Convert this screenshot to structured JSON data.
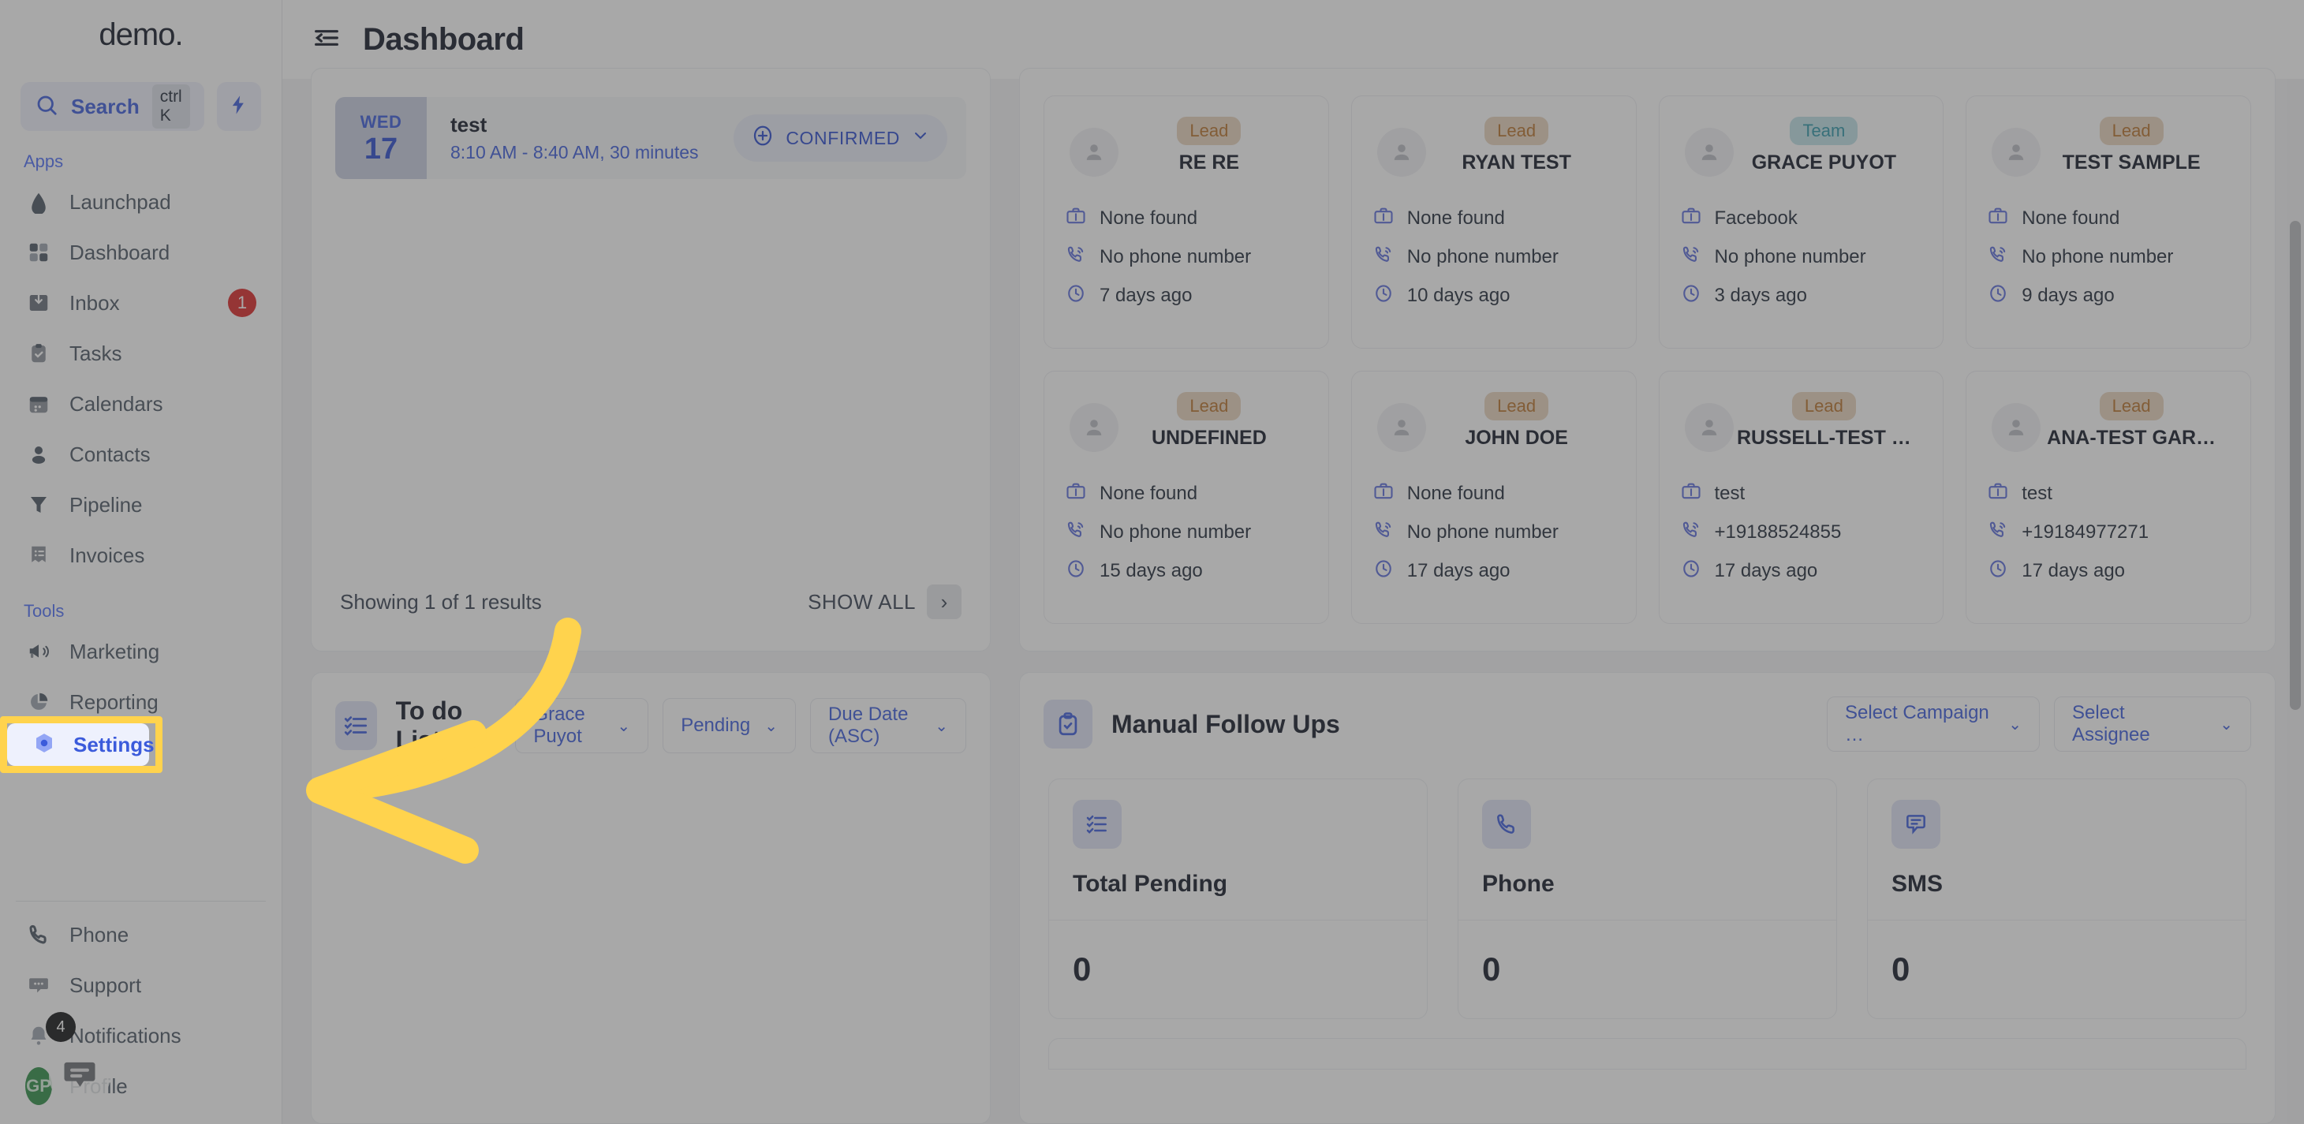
{
  "brand": {
    "name": "demo",
    "trademark": "."
  },
  "topbar": {
    "title": "Dashboard",
    "menu_icon": "collapse-menu-icon"
  },
  "search": {
    "label": "Search",
    "shortcut": "ctrl K",
    "icon": "search-icon",
    "bolt_icon": "bolt-icon"
  },
  "sidebar": {
    "sections": [
      {
        "label": "Apps",
        "items": [
          {
            "label": "Launchpad",
            "icon": "rocket-icon",
            "badge": ""
          },
          {
            "label": "Dashboard",
            "icon": "grid-icon",
            "badge": ""
          },
          {
            "label": "Inbox",
            "icon": "inbox-icon",
            "badge": "1"
          },
          {
            "label": "Tasks",
            "icon": "clipboard-check-icon",
            "badge": ""
          },
          {
            "label": "Calendars",
            "icon": "calendar-icon",
            "badge": ""
          },
          {
            "label": "Contacts",
            "icon": "person-icon",
            "badge": ""
          },
          {
            "label": "Pipeline",
            "icon": "funnel-icon",
            "badge": ""
          },
          {
            "label": "Invoices",
            "icon": "receipt-icon",
            "badge": ""
          }
        ]
      },
      {
        "label": "Tools",
        "items": [
          {
            "label": "Marketing",
            "icon": "megaphone-icon",
            "badge": ""
          },
          {
            "label": "Reporting",
            "icon": "pie-chart-icon",
            "badge": ""
          },
          {
            "label": "Settings",
            "icon": "hexagon-dot-icon",
            "badge": ""
          }
        ]
      }
    ],
    "bottom_items": [
      {
        "label": "Phone",
        "icon": "phone-icon",
        "badge": ""
      },
      {
        "label": "Support",
        "icon": "chat-dots-icon",
        "badge": ""
      },
      {
        "label": "Notifications",
        "icon": "bell-icon",
        "badge": "4"
      },
      {
        "label": "Profile",
        "icon": "avatar",
        "badge": ""
      }
    ],
    "profile_initials": "GP",
    "active_item": "Settings"
  },
  "appointments": {
    "items": [
      {
        "dow": "WED",
        "day": "17",
        "title": "test",
        "time": "8:10 AM - 8:40 AM, 30 minutes",
        "status": "CONFIRMED",
        "status_icon": "plus-circle-icon",
        "chevron": "chevron-down-icon"
      }
    ],
    "footer_text": "Showing 1 of 1 results",
    "show_all_label": "SHOW ALL",
    "show_all_chevron": "chevron-right-icon"
  },
  "contacts": {
    "cards": [
      {
        "badge": "Lead",
        "badge_type": "lead",
        "name": "RE RE",
        "source": "None found",
        "phone": "No phone number",
        "age": "7 days ago"
      },
      {
        "badge": "Lead",
        "badge_type": "lead",
        "name": "RYAN TEST",
        "source": "None found",
        "phone": "No phone number",
        "age": "10 days ago"
      },
      {
        "badge": "Team",
        "badge_type": "team",
        "name": "GRACE PUYOT",
        "source": "Facebook",
        "phone": "No phone number",
        "age": "3 days ago"
      },
      {
        "badge": "Lead",
        "badge_type": "lead",
        "name": "TEST SAMPLE",
        "source": "None found",
        "phone": "No phone number",
        "age": "9 days ago"
      },
      {
        "badge": "Lead",
        "badge_type": "lead",
        "name": "UNDEFINED",
        "source": "None found",
        "phone": "No phone number",
        "age": "15 days ago"
      },
      {
        "badge": "Lead",
        "badge_type": "lead",
        "name": "JOHN DOE",
        "source": "None found",
        "phone": "No phone number",
        "age": "17 days ago"
      },
      {
        "badge": "Lead",
        "badge_type": "lead",
        "name": "RUSSELL-TEST …",
        "source": "test",
        "phone": "+19188524855",
        "age": "17 days ago"
      },
      {
        "badge": "Lead",
        "badge_type": "lead",
        "name": "ANA-TEST GAR…",
        "source": "test",
        "phone": "+19184977271",
        "age": "17 days ago"
      }
    ],
    "icons": {
      "source": "briefcase-icon",
      "phone": "phone-call-icon",
      "time": "clock-icon",
      "avatar": "person-icon"
    }
  },
  "todo": {
    "title": "To do List",
    "icon": "checklist-icon",
    "filters": [
      {
        "label": "Grace Puyot",
        "chevron": "chevron-down-icon"
      },
      {
        "label": "Pending",
        "chevron": "chevron-down-icon"
      },
      {
        "label": "Due Date (ASC)",
        "chevron": "chevron-down-icon"
      }
    ]
  },
  "followups": {
    "title": "Manual Follow Ups",
    "icon": "clipboard-check-icon",
    "filters": [
      {
        "label": "Select Campaign …",
        "chevron": "chevron-down-icon"
      },
      {
        "label": "Select Assignee",
        "chevron": "chevron-down-icon"
      }
    ],
    "stats": [
      {
        "label": "Total Pending",
        "value": "0",
        "icon": "checklist-icon"
      },
      {
        "label": "Phone",
        "value": "0",
        "icon": "phone-icon"
      },
      {
        "label": "SMS",
        "value": "0",
        "icon": "sms-icon"
      }
    ]
  },
  "annotation": {
    "highlight_target": "Settings",
    "arrow": "curved-arrow-left",
    "color": "#ffd34d"
  },
  "colors": {
    "accent": "#3b5bdb",
    "highlight": "#ffd34d",
    "badge_lead_bg": "#e9d4bd",
    "badge_lead_text": "#b8712a",
    "badge_team_bg": "#bfe0e6",
    "badge_team_text": "#2d95a8",
    "unread_badge": "#dc2626"
  }
}
